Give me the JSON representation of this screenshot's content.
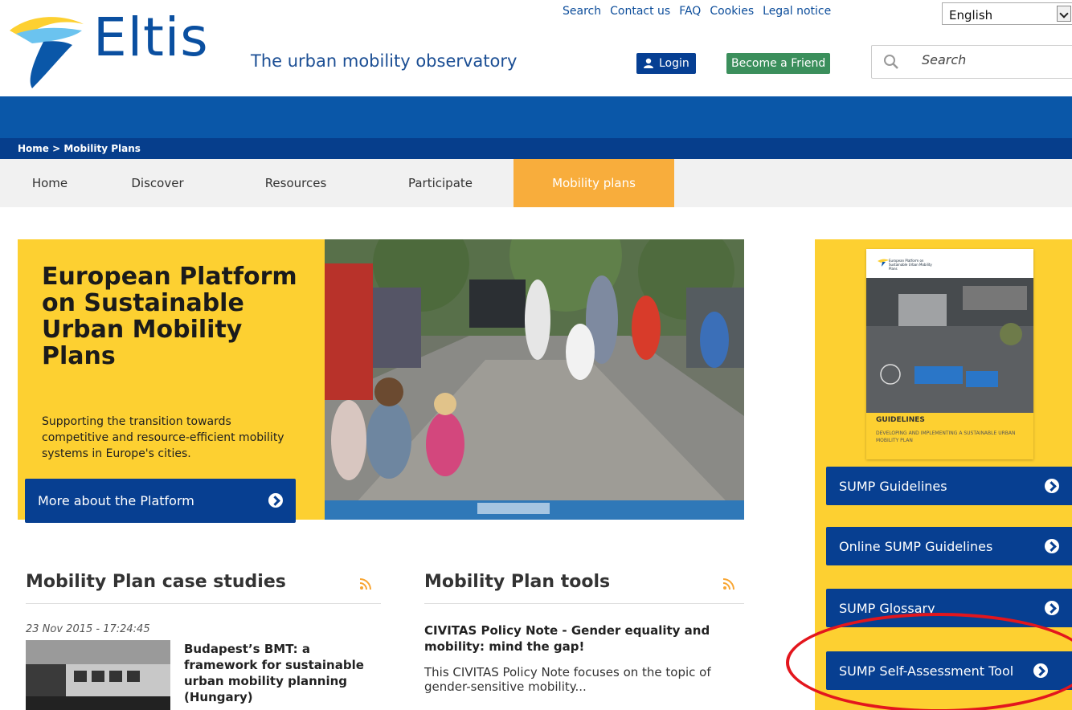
{
  "header": {
    "logo_text": "Eltis",
    "tagline": "The urban mobility observatory",
    "top_links": [
      "Search",
      "Contact us",
      "FAQ",
      "Cookies",
      "Legal notice"
    ],
    "language": "English",
    "login_label": "Login",
    "friend_label": "Become a Friend",
    "search_placeholder": "Search"
  },
  "breadcrumb": "Home > Mobility Plans",
  "nav": {
    "tabs": [
      {
        "label": "Home",
        "active": false
      },
      {
        "label": "Discover",
        "active": false
      },
      {
        "label": "Resources",
        "active": false
      },
      {
        "label": "Participate",
        "active": false
      },
      {
        "label": "Mobility plans",
        "active": true
      }
    ]
  },
  "hero": {
    "title": "European Platform on Sustainable Urban Mobility Plans",
    "subtitle": "Supporting the transition towards competitive and resource-efficient mobility systems in Europe's cities.",
    "button_label": "More about the Platform"
  },
  "sidebar": {
    "cover_org": "European Platform on Sustainable Urban Mobility Plans",
    "cover_title": "GUIDELINES",
    "cover_subtitle": "DEVELOPING AND IMPLEMENTING A SUSTAINABLE URBAN MOBILITY PLAN",
    "buttons": [
      "SUMP Guidelines",
      "Online SUMP Guidelines",
      "SUMP Glossary",
      "SUMP Self-Assessment Tool"
    ]
  },
  "case_studies": {
    "heading": "Mobility Plan case studies",
    "date": "23 Nov 2015 - 17:24:45",
    "title": "Budapest’s BMT: a framework for sustainable urban mobility planning (Hungary)"
  },
  "tools": {
    "heading": "Mobility Plan tools",
    "title": "CIVITAS Policy Note - Gender equality and mobility: mind the gap!",
    "description": "This CIVITAS Policy Note focuses on the topic of gender-sensitive mobility..."
  },
  "colors": {
    "brand_blue": "#073f91",
    "accent_yellow": "#fdd031",
    "active_tab": "#f8ad3c",
    "friend_green": "#3b8f5c",
    "annotation_red": "#e3161d"
  }
}
